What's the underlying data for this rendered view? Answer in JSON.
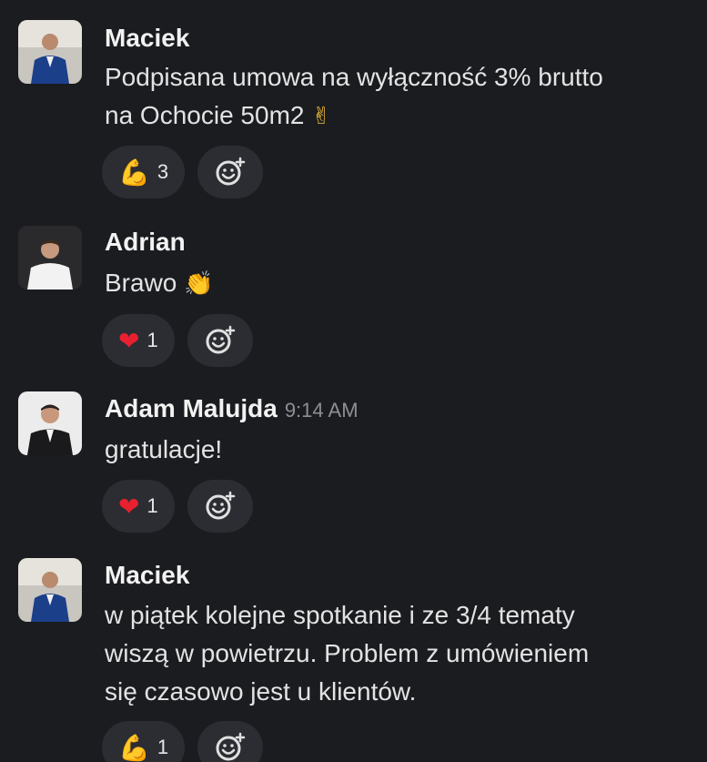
{
  "messages": [
    {
      "author": "Maciek",
      "time": "",
      "text_lines": [
        "Podpisana umowa na wyłączność 3% brutto",
        "na Ochocie 50m2"
      ],
      "text_emoji": "✌",
      "reaction": {
        "emoji": "💪",
        "emoji_name": "flexed-biceps-icon",
        "count": "3"
      }
    },
    {
      "author": "Adrian",
      "time": "",
      "text_lines": [
        "Brawo"
      ],
      "text_emoji": "👏",
      "reaction": {
        "emoji": "❤",
        "emoji_name": "heart-icon",
        "count": "1"
      }
    },
    {
      "author": "Adam Malujda",
      "time": "9:14 AM",
      "text_lines": [
        "gratulacje!"
      ],
      "text_emoji": "",
      "reaction": {
        "emoji": "❤",
        "emoji_name": "heart-icon",
        "count": "1"
      }
    },
    {
      "author": "Maciek",
      "time": "",
      "text_lines": [
        "w piątek kolejne spotkanie i ze 3/4 tematy",
        "wiszą w powietrzu. Problem z umówieniem",
        "się czasowo jest u klientów."
      ],
      "text_emoji": "",
      "reaction": {
        "emoji": "💪",
        "emoji_name": "flexed-biceps-icon",
        "count": "1"
      }
    }
  ],
  "colors": {
    "background": "#1b1c20",
    "pill": "#2b2d32",
    "heart": "#e8202f",
    "accent_yellow": "#f4b43a"
  }
}
